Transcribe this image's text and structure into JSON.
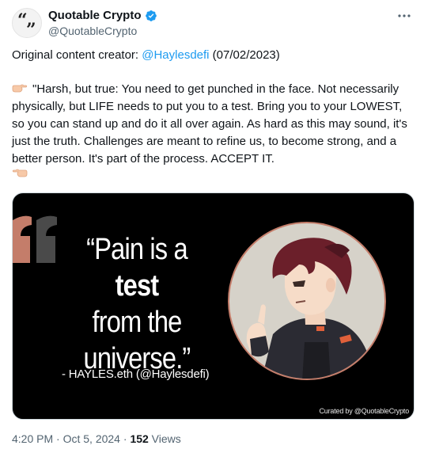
{
  "author": {
    "display_name": "Quotable Crypto",
    "handle": "@QuotableCrypto",
    "avatar_icon": "quote-marks-icon",
    "verified_icon": "verified-badge-icon",
    "verified_color": "#1d9bf0"
  },
  "more_icon": "more-horizontal-icon",
  "tweet": {
    "credit_prefix": "Original content creator: ",
    "credit_mention": "@Haylesdefi",
    "credit_suffix": " (07/02/2023)",
    "pointing_icon": "backhand-index-pointing-right-icon",
    "body": "\"Harsh, but true: You need to get punched in the face. Not necessarily physically, but LIFE needs to put you to a test. Bring you to your LOWEST, so you can stand up and do it all over again. As hard as this may sound, it's just the truth. Challenges are meant to refine us, to become strong, and a better person. It's part of the process. ACCEPT IT."
  },
  "media": {
    "quote_open": "“",
    "quote_line1_a": "Pain is a ",
    "quote_line1_b": "test",
    "quote_line2": "from the",
    "quote_line3": "universe.”",
    "attribution": "- HAYLES.eth  (@Haylesdefi)",
    "curated": "Curated by @QuotableCrypto",
    "accent_color": "#c47d6a"
  },
  "meta": {
    "time": "4:20 PM",
    "sep1": " · ",
    "date": "Oct 5, 2024",
    "sep2": " · ",
    "views_count": "152",
    "views_label": " Views"
  },
  "link_color": "#1d9bf0"
}
